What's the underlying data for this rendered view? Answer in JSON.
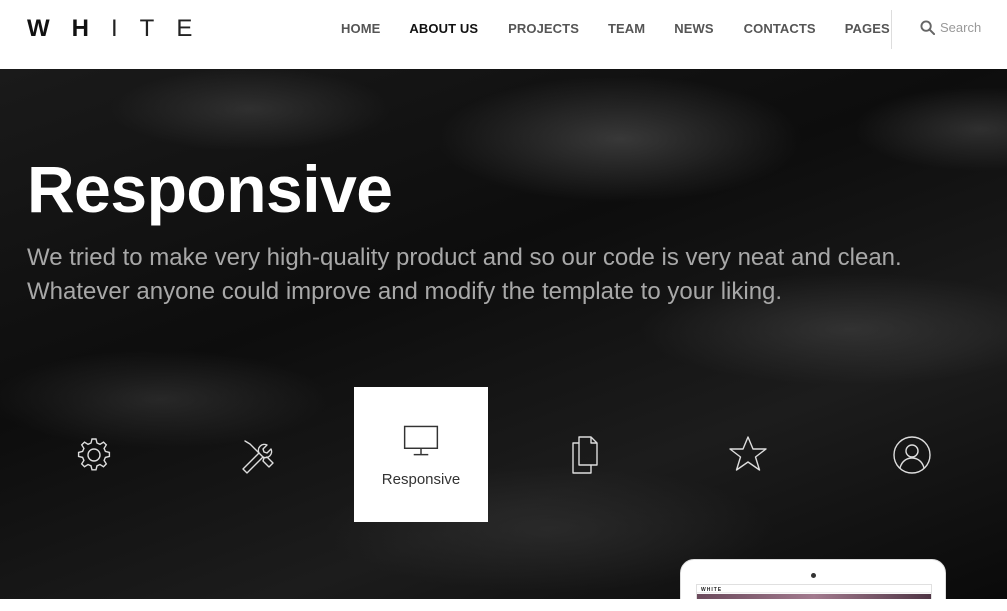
{
  "logo": {
    "letters": [
      "W",
      "H",
      "I",
      "T",
      "E"
    ]
  },
  "nav": {
    "items": [
      {
        "label": "HOME",
        "active": false
      },
      {
        "label": "ABOUT US",
        "active": true
      },
      {
        "label": "PROJECTS",
        "active": false
      },
      {
        "label": "TEAM",
        "active": false
      },
      {
        "label": "NEWS",
        "active": false
      },
      {
        "label": "CONTACTS",
        "active": false
      },
      {
        "label": "PAGES",
        "active": false
      }
    ]
  },
  "search": {
    "label": "Search",
    "icon": "search-icon"
  },
  "hero": {
    "title": "Responsive",
    "line1": "We tried to make very high-quality product and so our code is very neat and clean.",
    "line2": "Whatever anyone could improve and modify the template to your liking."
  },
  "features": [
    {
      "icon": "gear-icon",
      "label": "",
      "active": false
    },
    {
      "icon": "tools-icon",
      "label": "",
      "active": false
    },
    {
      "icon": "monitor-icon",
      "label": "Responsive",
      "active": true
    },
    {
      "icon": "documents-icon",
      "label": "",
      "active": false
    },
    {
      "icon": "star-icon",
      "label": "",
      "active": false
    },
    {
      "icon": "user-icon",
      "label": "",
      "active": false
    }
  ],
  "device_preview": {
    "mini_logo": "WHITE"
  },
  "colors": {
    "accent": "#ffffff",
    "hero_bg": "#111111",
    "nav_active": "#111111",
    "nav_text": "#555555"
  }
}
